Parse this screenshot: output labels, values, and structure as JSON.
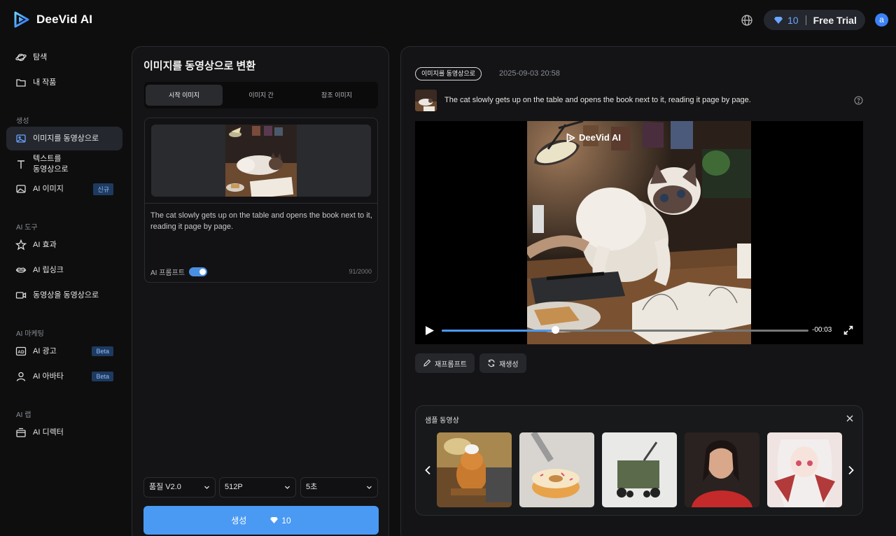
{
  "app": {
    "name": "DeeVid AI"
  },
  "header": {
    "credits": "10",
    "plan": "Free Trial",
    "avatar_letter": "a",
    "language_icon": "globe-icon"
  },
  "sidebar": {
    "items": [
      {
        "label": "탐색",
        "icon": "planet-icon"
      },
      {
        "label": "내 작품",
        "icon": "folder-icon"
      }
    ],
    "sections": [
      {
        "heading": "생성",
        "items": [
          {
            "label": "이미지를 동영상으로",
            "icon": "image-icon",
            "active": true
          },
          {
            "label": "텍스트를\n동영상으로",
            "icon": "text-icon"
          },
          {
            "label": "AI 이미지",
            "icon": "ai-image-icon",
            "badge": "신규"
          }
        ]
      },
      {
        "heading": "AI 도구",
        "items": [
          {
            "label": "AI 효과",
            "icon": "sparkle-icon"
          },
          {
            "label": "AI 립싱크",
            "icon": "lips-icon"
          },
          {
            "label": "동영상을 동영상으로",
            "icon": "video-icon"
          }
        ]
      },
      {
        "heading": "AI 마케팅",
        "items": [
          {
            "label": "AI 광고",
            "icon": "ad-icon",
            "badge": "Beta"
          },
          {
            "label": "AI 아바타",
            "icon": "avatar-icon",
            "badge": "Beta"
          }
        ]
      },
      {
        "heading": "AI 랩",
        "items": [
          {
            "label": "AI 디렉터",
            "icon": "director-icon"
          }
        ]
      }
    ]
  },
  "form": {
    "title": "이미지를 동영상으로 변환",
    "tabs": [
      "시작 이미지",
      "이미지 간",
      "참조 이미지"
    ],
    "prompt": "The cat slowly gets up on the table and opens the book next to it, reading it page by page.",
    "ai_prompt_label": "AI 프롬프트",
    "ai_prompt_enabled": true,
    "char_count": "91/2000",
    "quality": "품질 V2.0",
    "resolution": "512P",
    "duration": "5초",
    "generate_label": "생성",
    "generate_cost": "10"
  },
  "result": {
    "tag": "이미지를 동영상으로",
    "date": "2025-09-03 20:58",
    "prompt": "The cat slowly gets up on the table and opens the book next to it, reading it page by page.",
    "watermark": "DeeVid AI",
    "time_remaining": "-00:03",
    "progress": 0.31,
    "reprompt_label": "재프롬프트",
    "regenerate_label": "재생성"
  },
  "samples": {
    "title": "샘플 동영상",
    "items": [
      "cat-baking-thumbnail",
      "robot-donut-thumbnail",
      "wagon-thumbnail",
      "woman-portrait-thumbnail",
      "anime-girl-thumbnail"
    ]
  },
  "colors": {
    "accent": "#4a9af4",
    "background": "#0e0e0f",
    "panel": "#141416"
  }
}
